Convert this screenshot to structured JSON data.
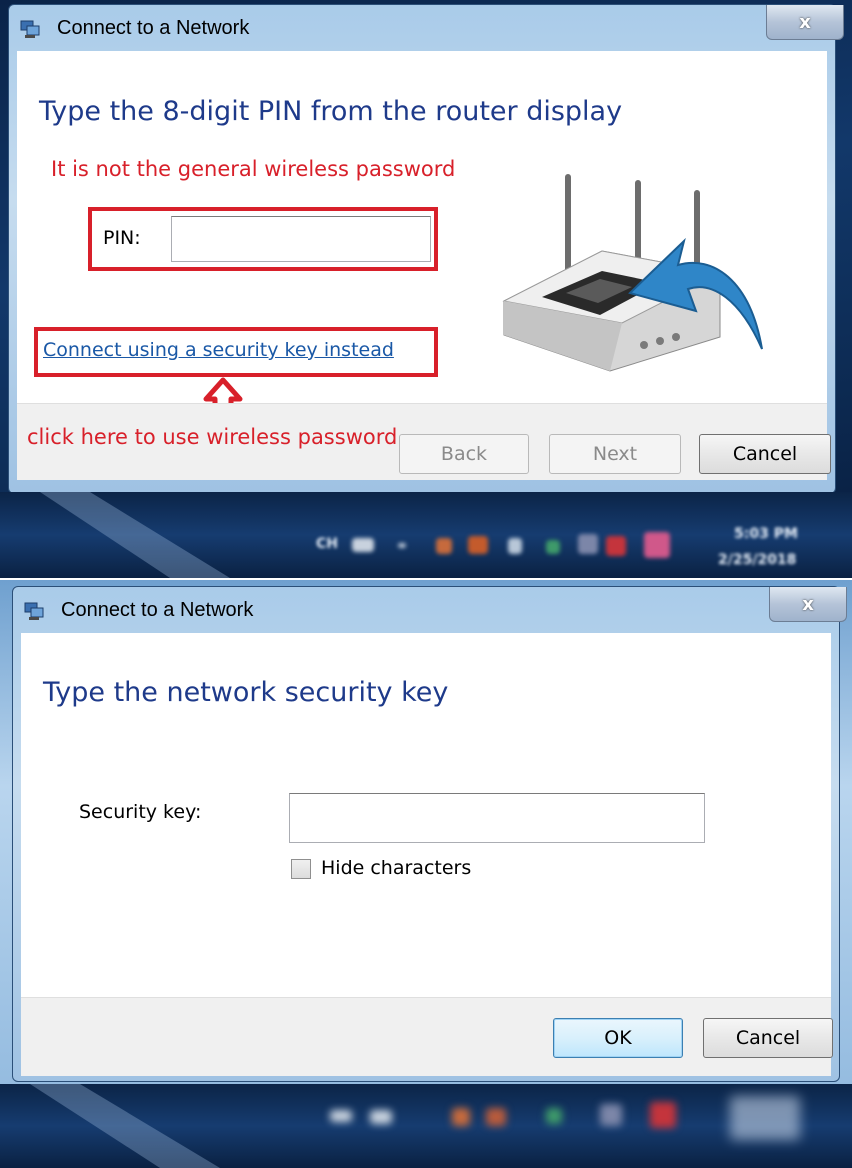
{
  "dialog_pin": {
    "title": "Connect to a Network",
    "close_label": "x",
    "heading": "Type the 8-digit PIN from the router display",
    "pin_label": "PIN:",
    "pin_value": "",
    "link_text": "Connect using a security key instead",
    "buttons": {
      "back": "Back",
      "next": "Next",
      "cancel": "Cancel"
    }
  },
  "annotations": {
    "note_top": "It is not the general wireless password",
    "note_bottom": "click here to use wireless password",
    "accent_color": "#d8202a"
  },
  "taskbar": {
    "lang": "CH",
    "clock_time": "5:03 PM",
    "clock_date": "2/25/2018"
  },
  "dialog_key": {
    "title": "Connect to a Network",
    "close_label": "x",
    "heading": "Type the network security key",
    "key_label": "Security key:",
    "key_value": "",
    "hide_characters_label": "Hide characters",
    "hide_characters_checked": false,
    "buttons": {
      "ok": "OK",
      "cancel": "Cancel"
    }
  }
}
